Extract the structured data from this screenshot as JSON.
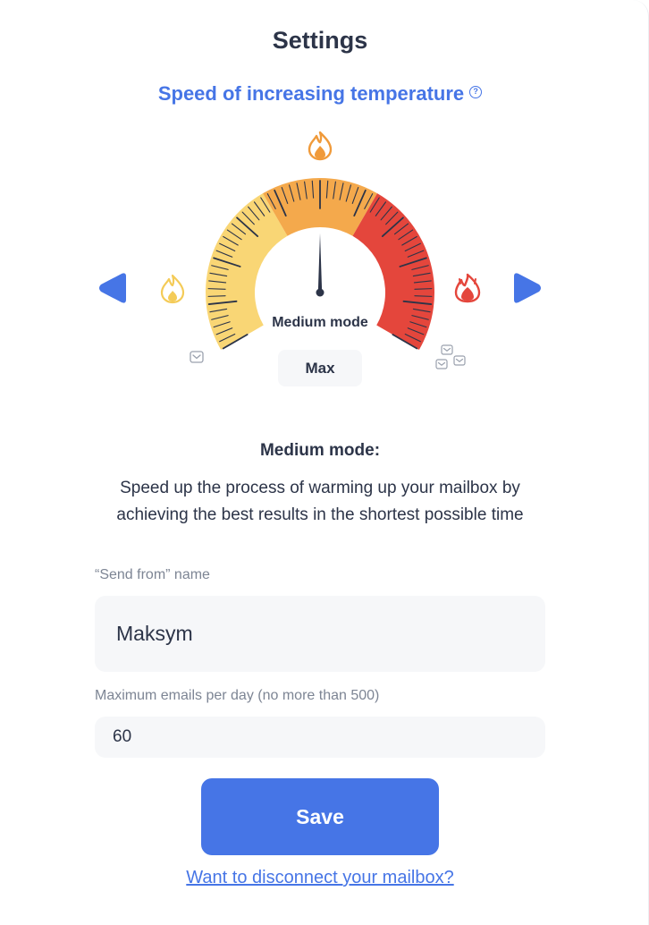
{
  "header": {
    "title": "Settings",
    "subtitle": "Speed of increasing temperature",
    "help_icon": "question-circle-icon"
  },
  "gauge": {
    "mode_label": "Medium mode",
    "selected_value": "Max",
    "level": 0.5,
    "segments": [
      {
        "name": "low",
        "color": "#f9d675"
      },
      {
        "name": "medium",
        "color": "#f4a94c"
      },
      {
        "name": "high",
        "color": "#e4463c"
      }
    ],
    "icons": {
      "left": "small-flame-icon",
      "top": "medium-flame-icon",
      "right": "big-flame-icon",
      "left_envelope": "envelope-icon",
      "right_envelopes": "envelopes-icon",
      "prev": "arrow-left-icon",
      "next": "arrow-right-icon"
    }
  },
  "description": {
    "title": "Medium mode:",
    "text": "Speed up the process of warming up your mailbox by achieving the best results in the shortest possible time"
  },
  "form": {
    "send_from_label": "“Send from” name",
    "send_from_value": "Maksym",
    "max_emails_label": "Maximum emails per day (no more than 500)",
    "max_emails_value": "60"
  },
  "actions": {
    "save_label": "Save",
    "disconnect_link": "Want to disconnect your mailbox?"
  },
  "colors": {
    "accent": "#4675e6",
    "text": "#2c3448",
    "muted": "#7d8594",
    "field_bg": "#f6f7f9"
  }
}
